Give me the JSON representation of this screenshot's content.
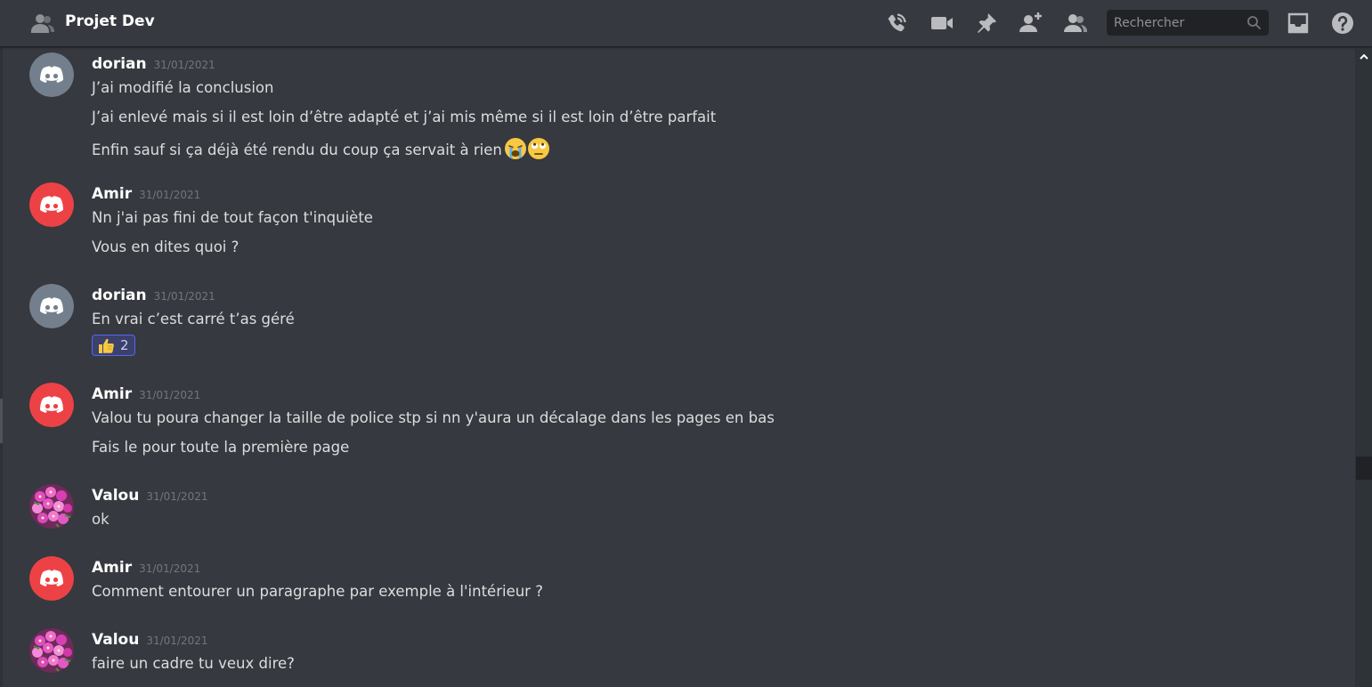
{
  "header": {
    "channel_icon": "group-icon",
    "title": "Projet Dev",
    "toolbar": [
      {
        "name": "voice-call-icon"
      },
      {
        "name": "video-call-icon"
      },
      {
        "name": "pin-icon"
      },
      {
        "name": "add-friend-icon"
      },
      {
        "name": "member-list-icon"
      }
    ],
    "search": {
      "placeholder": "Rechercher",
      "value": ""
    },
    "inbox_icon": "inbox-icon",
    "help_icon": "help-icon"
  },
  "colors": {
    "background": "#36393f",
    "avatar_gray": "#747f8d",
    "avatar_red": "#ed4245",
    "reaction_bg": "#3b416b",
    "reaction_border": "#5865f2"
  },
  "messages": [
    {
      "author": "dorian",
      "timestamp": "31/01/2021",
      "avatar": "discord-gray",
      "lines": [
        "J’ai modifié la conclusion",
        "J’ai enlevé mais si il est loin d’être adapté et j’ai mis même si il est loin d’être parfait",
        "Enfin sauf si ça déjà été rendu du coup ça servait à rien"
      ],
      "emojis": [
        "crying-face-emoji",
        "eye-roll-emoji"
      ]
    },
    {
      "author": "Amir",
      "timestamp": "31/01/2021",
      "avatar": "discord-red",
      "lines": [
        "Nn j'ai pas fini de tout façon t'inquiète",
        "Vous en dites quoi ?"
      ]
    },
    {
      "author": "dorian",
      "timestamp": "31/01/2021",
      "avatar": "discord-gray",
      "lines": [
        "En vrai c’est carré t’as géré"
      ],
      "reaction": {
        "emoji": "thumbs-up-emoji",
        "count": "2"
      }
    },
    {
      "author": "Amir",
      "timestamp": "31/01/2021",
      "avatar": "discord-red",
      "lines": [
        "Valou tu poura changer la taille de police stp si nn y'aura un décalage dans les pages en bas",
        "Fais le pour toute la première page"
      ]
    },
    {
      "author": "Valou",
      "timestamp": "31/01/2021",
      "avatar": "flowers-photo",
      "lines": [
        "ok"
      ]
    },
    {
      "author": "Amir",
      "timestamp": "31/01/2021",
      "avatar": "discord-red",
      "lines": [
        "Comment entourer un paragraphe par exemple à l'intérieur ?"
      ]
    },
    {
      "author": "Valou",
      "timestamp": "31/01/2021",
      "avatar": "flowers-photo",
      "lines": [
        "faire un cadre tu veux dire?"
      ]
    }
  ]
}
